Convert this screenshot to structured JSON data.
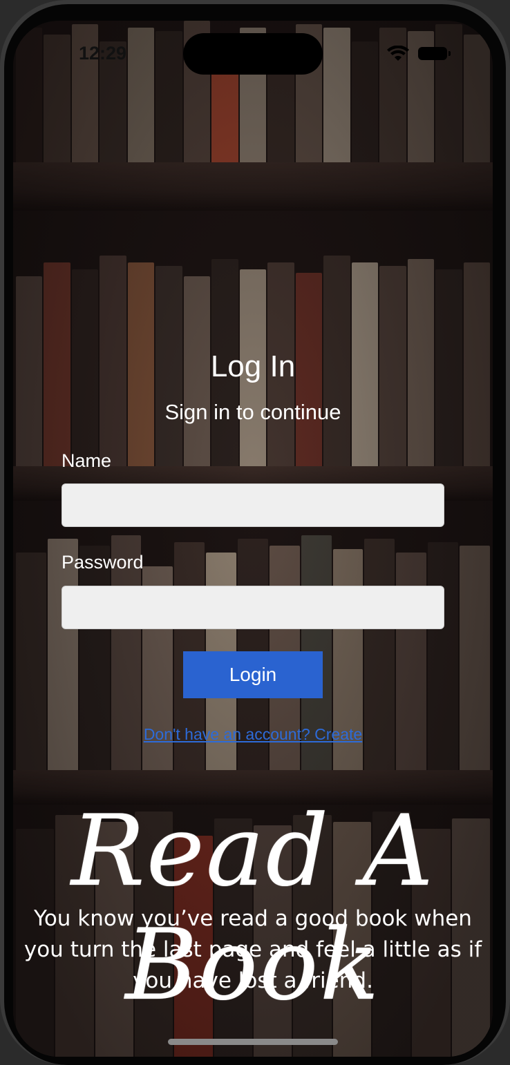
{
  "status_bar": {
    "time": "12:29",
    "wifi_icon": "wifi-icon",
    "battery_icon": "battery-icon"
  },
  "login": {
    "title": "Log In",
    "subtitle": "Sign in to continue",
    "name_label": "Name",
    "name_value": "",
    "password_label": "Password",
    "password_value": "",
    "login_button": "Login",
    "create_link": "Don't have an account? Create"
  },
  "branding": {
    "logo": "Read A Book",
    "quote": "You know you’ve read a good book when you turn the last page and feel a little as if you have lost a friend."
  },
  "colors": {
    "button": "#2a63d0",
    "link": "#2d6bd9",
    "field_bg": "#efefef"
  }
}
